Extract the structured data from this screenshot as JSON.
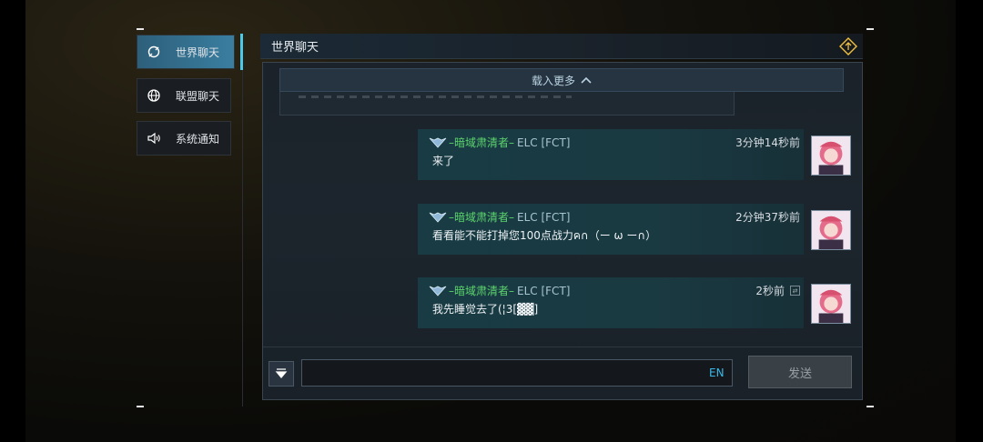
{
  "sidebar": {
    "items": [
      {
        "label": "世界聊天",
        "icon": "chat-cycle-icon",
        "active": true
      },
      {
        "label": "联盟聊天",
        "icon": "globe-icon",
        "active": false
      },
      {
        "label": "系统通知",
        "icon": "speaker-icon",
        "active": false
      }
    ]
  },
  "header": {
    "title": "世界聊天",
    "icon": "diamond-arrow-icon"
  },
  "chat": {
    "load_more": "载入更多",
    "messages": [
      {
        "name": "–暗域肃清者–",
        "tag": "ELC [FCT]",
        "time": "3分钟14秒前",
        "text": "来了",
        "translate_icon": false
      },
      {
        "name": "–暗域肃清者–",
        "tag": "ELC [FCT]",
        "time": "2分钟37秒前",
        "text": "看看能不能打掉您100点战力ค∩（ー ω ー∩）",
        "translate_icon": false
      },
      {
        "name": "–暗域肃清者–",
        "tag": "ELC [FCT]",
        "time": "2秒前",
        "text": "我先睡觉去了(¦3[▓▓]",
        "translate_icon": true
      }
    ]
  },
  "input": {
    "value": "",
    "lang": "EN"
  },
  "send_button": {
    "label": "发送"
  },
  "colors": {
    "accent": "#4cc8e8",
    "name_green": "#5cd36c",
    "active_tab": "#3a7ea0"
  }
}
